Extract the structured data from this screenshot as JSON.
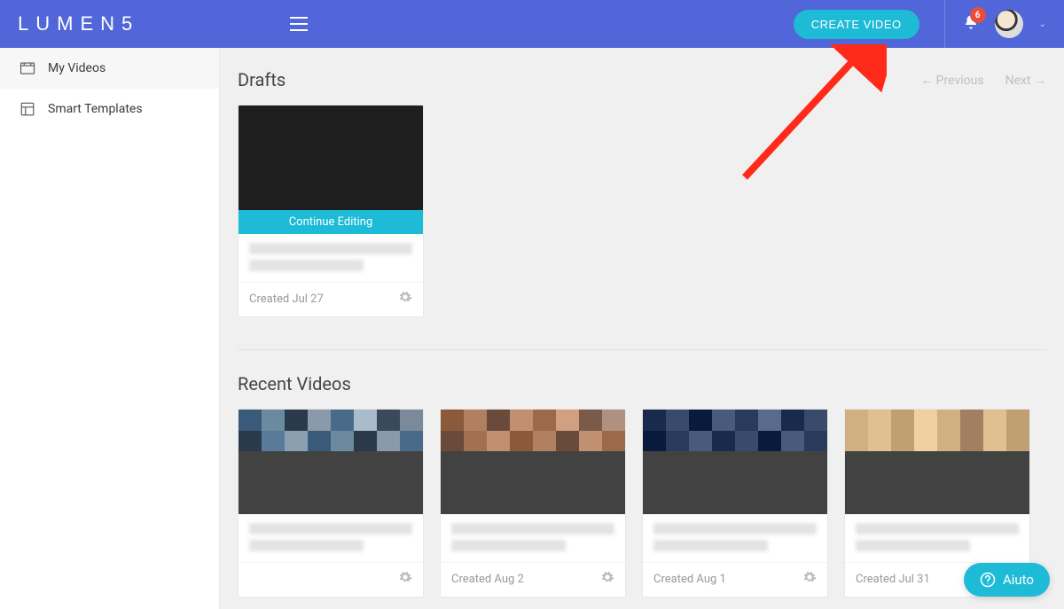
{
  "brand": "LUMEN5",
  "header": {
    "create_label": "CREATE VIDEO",
    "notification_count": "6"
  },
  "sidebar": {
    "items": [
      {
        "label": "My Videos"
      },
      {
        "label": "Smart Templates"
      }
    ]
  },
  "sections": {
    "drafts": {
      "title": "Drafts",
      "pager_prev": "← Previous",
      "pager_next": "Next →",
      "cards": [
        {
          "continue_label": "Continue Editing",
          "created": "Created Jul 27"
        }
      ]
    },
    "recent": {
      "title": "Recent Videos",
      "cards": [
        {
          "created": ""
        },
        {
          "created": "Created Aug 2"
        },
        {
          "created": "Created Aug 1"
        },
        {
          "created": "Created Jul 31"
        }
      ]
    }
  },
  "help": {
    "label": "Aiuto"
  }
}
